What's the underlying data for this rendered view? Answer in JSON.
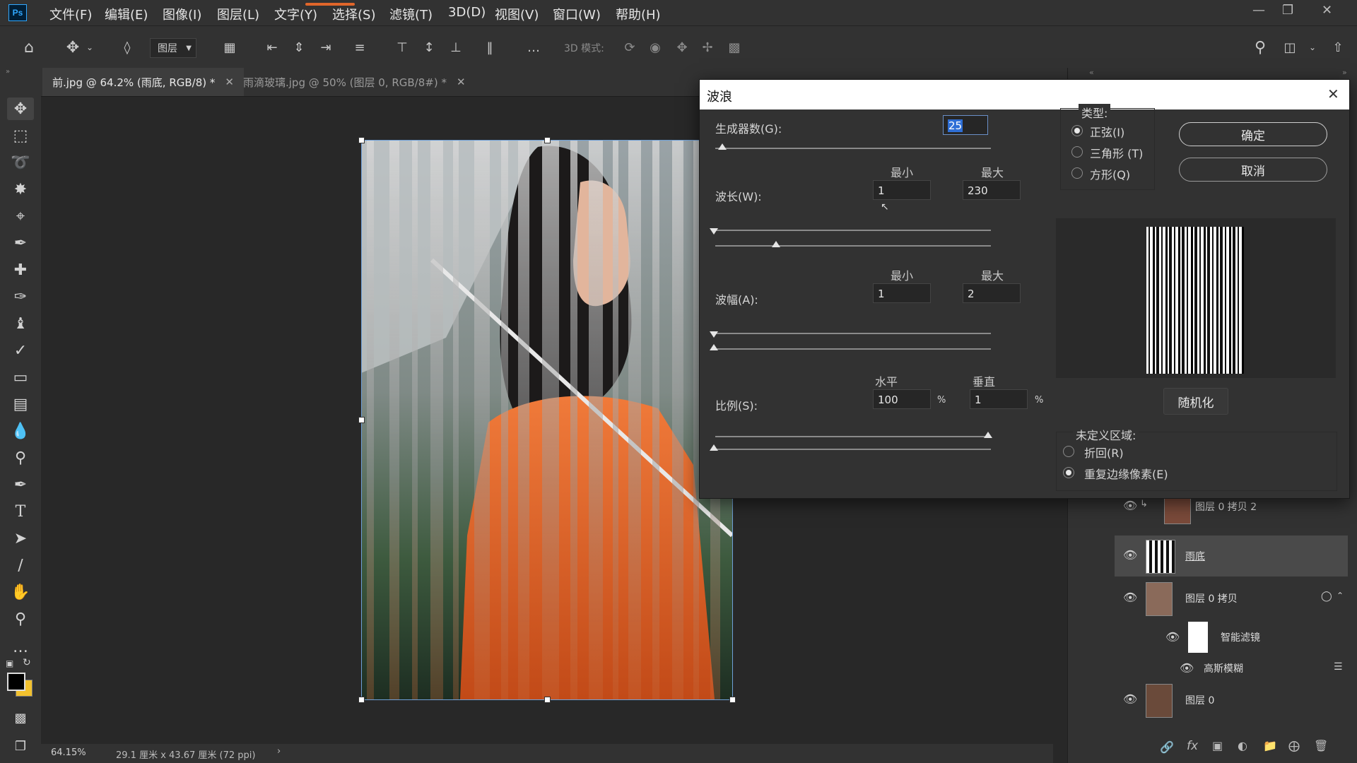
{
  "app": {
    "logo": "Ps"
  },
  "menu": [
    "文件(F)",
    "编辑(E)",
    "图像(I)",
    "图层(L)",
    "文字(Y)",
    "选择(S)",
    "滤镜(T)",
    "3D(D)",
    "视图(V)",
    "窗口(W)",
    "帮助(H)"
  ],
  "options_bar": {
    "layer_select": "图层",
    "mode_3d_label": "3D 模式:"
  },
  "tabs": [
    {
      "label": "前.jpg @ 64.2% (雨底, RGB/8) *"
    },
    {
      "label": "雨滴玻璃.jpg @ 50% (图层 0, RGB/8#) *"
    }
  ],
  "status": {
    "zoom": "64.15%",
    "doc_size": "29.1 厘米 x 43.67 厘米 (72 ppi)"
  },
  "dialog": {
    "title": "波浪",
    "generators": {
      "label": "生成器数(G):",
      "value": "25"
    },
    "col_min": "最小",
    "col_max": "最大",
    "wavelength": {
      "label": "波长(W):",
      "min": "1",
      "max": "230"
    },
    "amplitude": {
      "label": "波幅(A):",
      "min": "1",
      "max": "2"
    },
    "scale": {
      "label": "比例(S):",
      "horiz_label": "水平",
      "vert_label": "垂直",
      "horiz": "100",
      "vert": "1",
      "unit": "%"
    },
    "type": {
      "label": "类型:",
      "options": [
        "正弦(I)",
        "三角形 (T)",
        "方形(Q)"
      ],
      "selected": 0
    },
    "ok": "确定",
    "cancel": "取消",
    "randomize": "随机化",
    "undefined_area": {
      "label": "未定义区域:",
      "options": [
        "折回(R)",
        "重复边缘像素(E)"
      ],
      "selected": 1
    }
  },
  "layers": [
    {
      "name": "图层 0 拷贝 2"
    },
    {
      "name": "雨底"
    },
    {
      "name": "图层 0 拷贝"
    },
    {
      "name": "智能滤镜"
    },
    {
      "name": "高斯模糊"
    },
    {
      "name": "图层 0"
    }
  ],
  "colors": {
    "accent": "#31a8ff",
    "orange": "#e0662a",
    "panel": "#323232"
  }
}
